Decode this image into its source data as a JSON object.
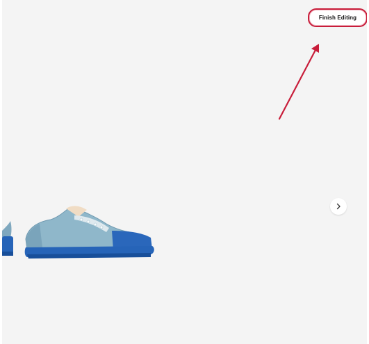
{
  "toolbar": {
    "finish_label": "Finish Editing"
  },
  "icons": {
    "next": "chevron-right-icon",
    "annotation": "red-arrow-icon"
  },
  "colors": {
    "background": "#f4f4f4",
    "highlight": "#c81d3a",
    "shoe_body": "#8bb7cc",
    "shoe_sole": "#1f5fb3"
  }
}
